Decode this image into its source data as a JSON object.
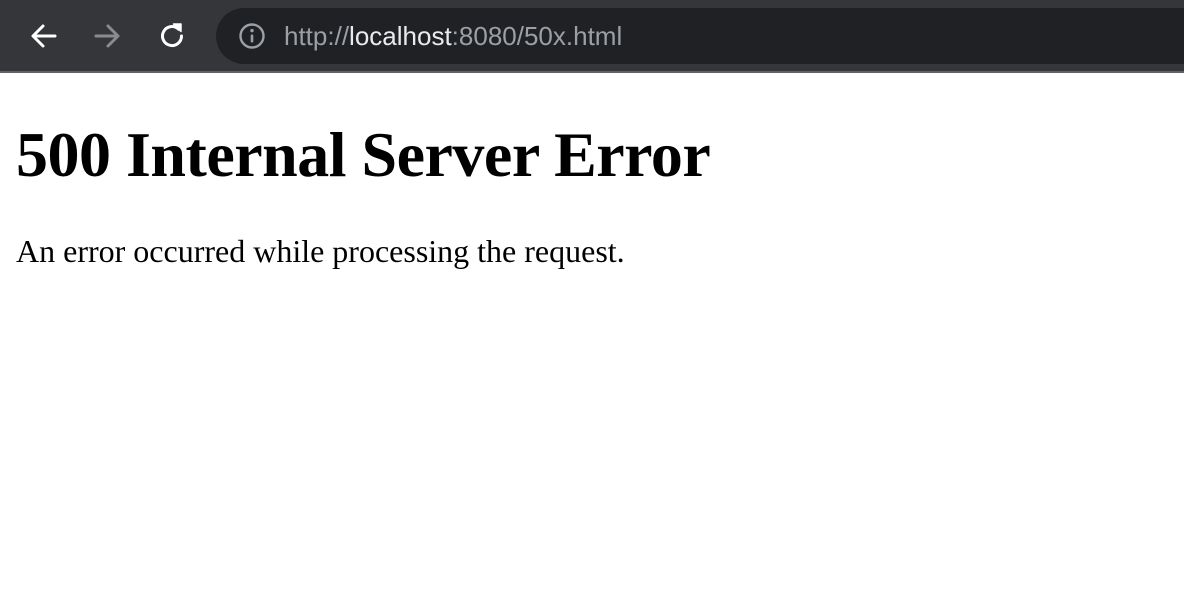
{
  "browser": {
    "icons": {
      "back": "arrow-left-icon",
      "forward": "arrow-right-icon",
      "reload": "reload-icon",
      "site_info": "info-icon"
    },
    "colors": {
      "toolbar": "#35363a",
      "omnibox": "#202124",
      "url_dim": "#9aa0a6",
      "url_host": "#e8eaed",
      "forward_disabled": "#8a8b8e"
    },
    "url": {
      "scheme": "http://",
      "host": "localhost",
      "rest": ":8080/50x.html"
    }
  },
  "page": {
    "heading": "500 Internal Server Error",
    "message": "An error occurred while processing the request."
  }
}
